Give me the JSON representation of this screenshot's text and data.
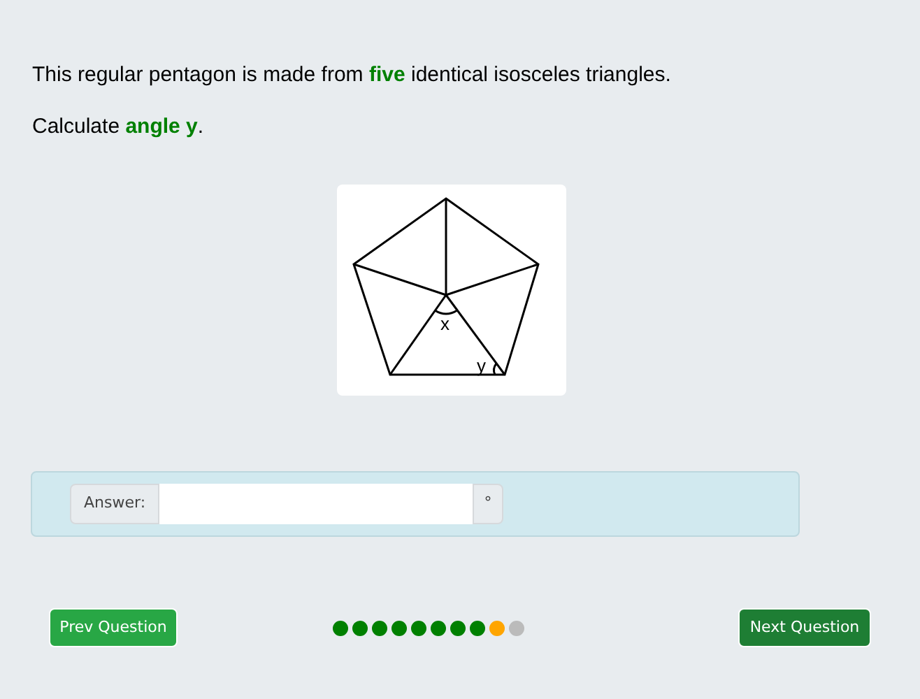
{
  "question": [
    "This regular pentagon is made from **five** identical isosceles triangles.",
    "Calculate **angle y**."
  ],
  "diagram": {
    "labels": [
      "x",
      "y"
    ]
  },
  "answer": {
    "label": "Answer:",
    "unit": "°"
  },
  "prev_button": "Prev Question",
  "next_button": "Next Question",
  "progress": [
    {
      "color": "#008000"
    },
    {
      "color": "#008000"
    },
    {
      "color": "#008000"
    },
    {
      "color": "#008000"
    },
    {
      "color": "#008000"
    },
    {
      "color": "#008000"
    },
    {
      "color": "#008000"
    },
    {
      "color": "#008000"
    },
    {
      "color": "#ffa500"
    },
    {
      "color": "#bbbbbb"
    }
  ]
}
